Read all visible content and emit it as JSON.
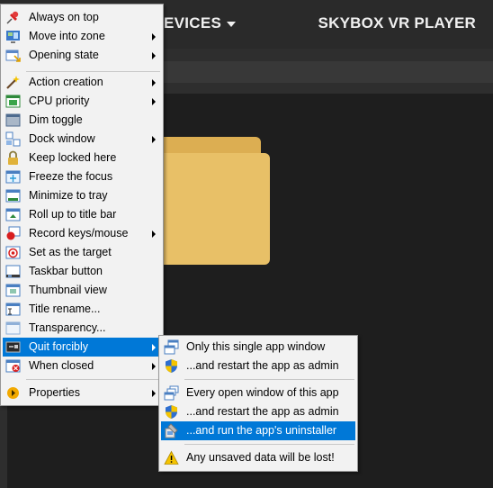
{
  "app": {
    "nav_devices": "EVICES",
    "title": "SKYBOX VR PLAYER"
  },
  "main_menu": {
    "items": [
      {
        "label": "Always on top",
        "icon": "pin-icon",
        "has_submenu": false
      },
      {
        "label": "Move into zone",
        "icon": "monitor-zone-icon",
        "has_submenu": true
      },
      {
        "label": "Opening state",
        "icon": "opening-state-icon",
        "has_submenu": true
      },
      {
        "label": "Action creation",
        "icon": "magic-wand-icon",
        "has_submenu": true
      },
      {
        "label": "CPU priority",
        "icon": "cpu-icon",
        "has_submenu": true
      },
      {
        "label": "Dim toggle",
        "icon": "dim-window-icon",
        "has_submenu": false
      },
      {
        "label": "Dock window",
        "icon": "dock-window-icon",
        "has_submenu": true
      },
      {
        "label": "Keep locked here",
        "icon": "lock-icon",
        "has_submenu": false
      },
      {
        "label": "Freeze the focus",
        "icon": "freeze-icon",
        "has_submenu": false
      },
      {
        "label": "Minimize to tray",
        "icon": "tray-icon",
        "has_submenu": false
      },
      {
        "label": "Roll up to title bar",
        "icon": "roll-up-icon",
        "has_submenu": false
      },
      {
        "label": "Record keys/mouse",
        "icon": "record-icon",
        "has_submenu": true
      },
      {
        "label": "Set as the target",
        "icon": "target-icon",
        "has_submenu": false
      },
      {
        "label": "Taskbar button",
        "icon": "taskbar-icon",
        "has_submenu": false
      },
      {
        "label": "Thumbnail view",
        "icon": "thumbnail-icon",
        "has_submenu": false
      },
      {
        "label": "Title rename...",
        "icon": "rename-icon",
        "has_submenu": false
      },
      {
        "label": "Transparency...",
        "icon": "transparency-icon",
        "has_submenu": false
      },
      {
        "label": "Quit forcibly",
        "icon": "quit-icon",
        "has_submenu": true,
        "selected": true
      },
      {
        "label": "When closed",
        "icon": "when-closed-icon",
        "has_submenu": true
      },
      {
        "label": "Properties",
        "icon": "properties-arrow-icon",
        "has_submenu": true
      }
    ]
  },
  "sub_menu": {
    "items": [
      {
        "label": "Only this single app window",
        "icon": "single-window-icon"
      },
      {
        "label": "...and restart the app as admin",
        "icon": "uac-shield-icon"
      },
      {
        "label": "Every open window of this app",
        "icon": "all-windows-icon"
      },
      {
        "label": "...and restart the app as admin",
        "icon": "uac-shield-icon"
      },
      {
        "label": "...and run the app's uninstaller",
        "icon": "uninstaller-icon",
        "selected": true
      },
      {
        "label": "Any unsaved data will be lost!",
        "icon": "warning-icon"
      }
    ]
  },
  "colors": {
    "menu_bg": "#f2f2f2",
    "highlight": "#0078d7",
    "app_bg": "#1e1e1e",
    "folder": "#e8bf62"
  }
}
